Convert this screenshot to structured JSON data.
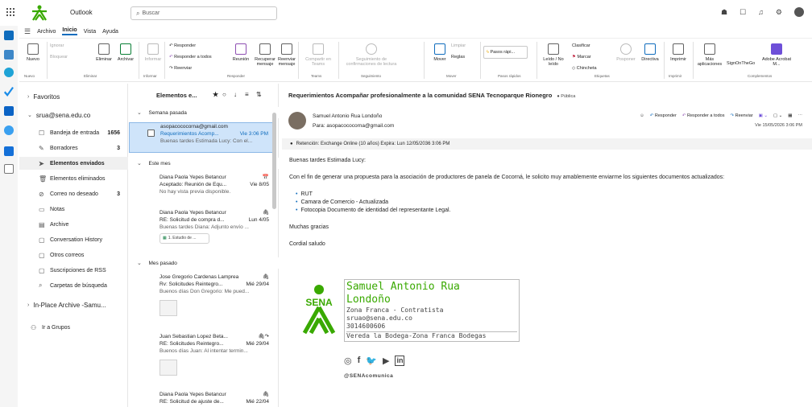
{
  "titlebar": {
    "app": "Outlook",
    "search_placeholder": "Buscar"
  },
  "menu": {
    "tabs": [
      "Archivo",
      "Inicio",
      "Vista",
      "Ayuda"
    ],
    "active": "Inicio"
  },
  "ribbon": {
    "nuevo": "Nuevo",
    "ignorar": "Ignorar",
    "bloquear": "Bloquear",
    "eliminar": "Eliminar",
    "archivar": "Archivar",
    "informar": "Informar",
    "responder": "Responder",
    "responder_todos": "Responder a todos",
    "reenviar": "Reenviar",
    "reunion": "Reunión",
    "recuperar": "Recuperar mensaje",
    "reenviar_mensaje": "Reenviar mensaje",
    "compartir": "Compartir en Teams",
    "seguimiento": "Seguimiento de confirmaciones de lectura",
    "mover": "Mover",
    "limpiar": "Limpiar",
    "reglas": "Reglas",
    "pasos": "Pasos rápi...",
    "leido": "Leído / No leído",
    "clasificar": "Clasificar",
    "marcar": "Marcar",
    "chincheta": "Chincheta",
    "posponer": "Posponer",
    "directiva": "Directiva",
    "imprimir": "Imprimir",
    "mas": "Más aplicaciones",
    "signon": "SignOnTheGo",
    "adobe": "Adobe Acrobat M...",
    "groups": [
      "Nuevo",
      "Eliminar",
      "Informar",
      "Responder",
      "Teams",
      "Seguimiento",
      "Mover",
      "Pasos rápidos",
      "Etiquetas",
      "Imprimir",
      "Complementos"
    ]
  },
  "folders": {
    "favoritos": "Favoritos",
    "account": "srua@sena.edu.co",
    "items": [
      {
        "label": "Bandeja de entrada",
        "count": "1656"
      },
      {
        "label": "Borradores",
        "count": "3"
      },
      {
        "label": "Elementos enviados",
        "count": ""
      },
      {
        "label": "Elementos eliminados",
        "count": ""
      },
      {
        "label": "Correo no deseado",
        "count": "3"
      },
      {
        "label": "Notas",
        "count": ""
      },
      {
        "label": "Archive",
        "count": ""
      },
      {
        "label": "Conversation History",
        "count": ""
      },
      {
        "label": "Otros correos",
        "count": ""
      },
      {
        "label": "Suscripciones de RSS",
        "count": ""
      },
      {
        "label": "Carpetas de búsqueda",
        "count": ""
      }
    ],
    "archive": "In-Place Archive -Samu...",
    "grupos": "Ir a Grupos"
  },
  "list": {
    "title": "Elementos e...",
    "sections": [
      "Semana pasada",
      "Este mes",
      "Mes pasado"
    ],
    "messages": [
      {
        "from": "asopacococorna@gmail.com",
        "subject": "Requerimientos Acomp...",
        "date": "Vie 3:06 PM",
        "preview": "Buenas tardes Estimada Lucy: Con el..."
      },
      {
        "from": "Diana Paola Yepes Betancur",
        "subject": "Aceptado: Reunión de Equ...",
        "date": "Vie 8/05",
        "preview": "No hay vista previa disponible."
      },
      {
        "from": "Diana Paola Yepes Betancur",
        "subject": "RE: Solicitud de compra d...",
        "date": "Lun 4/05",
        "preview": "Buenas tardes Diana: Adjunto envío ...",
        "attachment": "1. Estudio de ..."
      },
      {
        "from": "Jose Gregorio Cardenas Lamprea",
        "subject": "Rv: Solicitudes Reintegro...",
        "date": "Mié 29/04",
        "preview": "Buenos días Don Gregorio: Me pued..."
      },
      {
        "from": "Juan Sebastian Lopez Beta...",
        "subject": "RE: Solicitudes Reintegro...",
        "date": "Mié 29/04",
        "preview": "Buenos días Juan: Al intentar termin..."
      },
      {
        "from": "Diana Paola Yepes Betancur",
        "subject": "RE: Solicitud de ajuste de...",
        "date": "Mié 22/04",
        "preview": ""
      }
    ]
  },
  "reader": {
    "subject": "Requerimientos Acompañar profesionalmente a la comunidad SENA Tecnoparque Rionegro",
    "badge": "Pública",
    "sender": "Samuel Antonio Rua Londoño",
    "to": "Para:  asopacococorna@gmail.com",
    "actions": [
      "Responder",
      "Responder a todos",
      "Reenviar"
    ],
    "date": "Vie 15/05/2026 3:06 PM",
    "retention": "Retención: Exchange Online (10 años) Expira: Lun 12/05/2036 3:06 PM",
    "greeting": "Buenas tardes Estimada Lucy:",
    "para1": "Con el fin de generar una propuesta para la asociación de productores de panela de Cocorná, le solicito muy amablemente enviarme los siguientes documentos actualizados:",
    "bullets": [
      "RUT",
      "Camara de Comercio - Actualizada",
      "Fotocopia Documento de identidad del representante Legal."
    ],
    "thanks": "Muchas gracias",
    "regards": "Cordial saludo",
    "signature": {
      "name1": "Samuel Antonio Rua",
      "name2": "Londoño",
      "line1": "Zona Franca - Contratista",
      "line2": "sruao@sena.edu.co",
      "line3": "3014600606",
      "line4": "Vereda la Bodega-Zona Franca Bodegas",
      "logo_text": "SENA",
      "handle": "@SENAcomunica"
    }
  },
  "colors": {
    "accent": "#0f6cbd",
    "sena_green": "#39a900",
    "selected": "#cfe4fa"
  }
}
